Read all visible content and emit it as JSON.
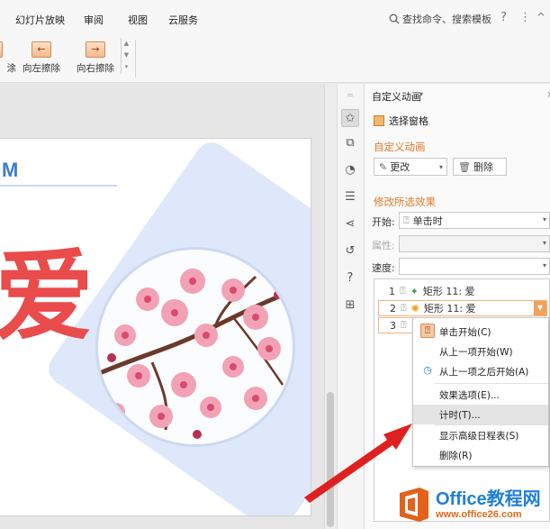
{
  "menubar": {
    "items": [
      "幻灯片放映",
      "审阅",
      "视图",
      "云服务"
    ],
    "search": "查找命令、搜索模板",
    "help": "?",
    "more": "⋮",
    "collapse": "^"
  },
  "ribbon": {
    "cut_label": "涂",
    "wipe_left": "向左擦除",
    "wipe_right": "向右擦除"
  },
  "slide": {
    "tag_text": "M",
    "big_char": "爱"
  },
  "pane": {
    "title": "自定义动画",
    "selection_pane": "选择窗格",
    "section_custom": "自定义动画",
    "change_btn": "更改",
    "delete_btn": "删除",
    "section_modify": "修改所选效果",
    "start_label": "开始:",
    "start_value": "单击时",
    "property_label": "属性:",
    "speed_label": "速度:",
    "animations": [
      {
        "num": "1",
        "name": "矩形 11: 爱"
      },
      {
        "num": "2",
        "name": "矩形 11: 爱"
      },
      {
        "num": "3",
        "name": ""
      }
    ]
  },
  "context_menu": {
    "items": [
      "单击开始(C)",
      "从上一项开始(W)",
      "从上一项之后开始(A)",
      "效果选项(E)...",
      "计时(T)...",
      "显示高级日程表(S)",
      "删除(R)"
    ],
    "highlighted_index": 4
  },
  "watermark": {
    "brand": "Office教程网",
    "url": "www.office26.com"
  },
  "colors": {
    "accent_orange": "#e07a2a",
    "highlight_red": "#e02020",
    "slide_red": "#ea4b4b",
    "slide_blue": "#3b7cd0"
  }
}
